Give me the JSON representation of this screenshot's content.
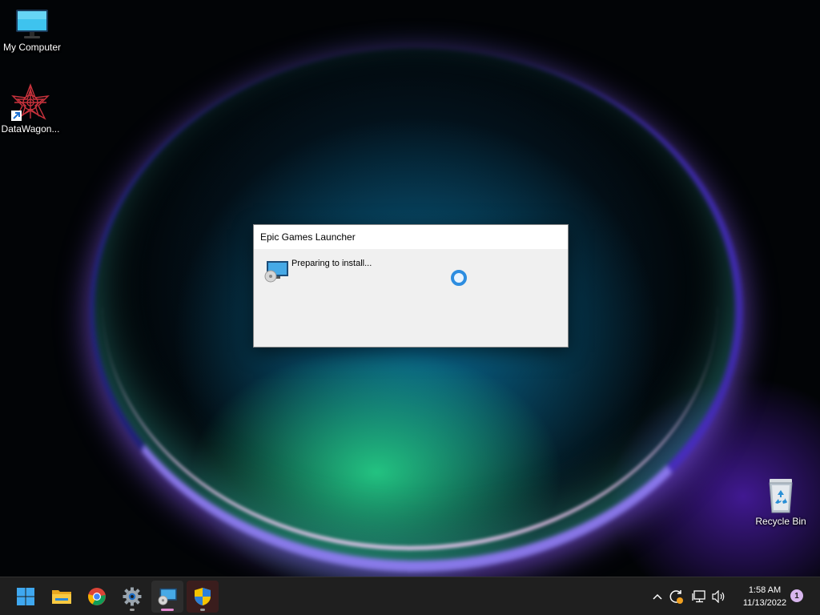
{
  "desktop": {
    "icons": [
      {
        "label": "My Computer"
      },
      {
        "label": "DataWagon..."
      },
      {
        "label": "Recycle Bin"
      }
    ]
  },
  "dialog": {
    "title": "Epic Games Launcher",
    "status": "Preparing to install..."
  },
  "taskbar": {
    "apps": [
      {
        "name": "start-icon"
      },
      {
        "name": "file-explorer-icon"
      },
      {
        "name": "chrome-icon"
      },
      {
        "name": "settings-icon"
      },
      {
        "name": "installer-icon"
      },
      {
        "name": "security-shield-icon"
      }
    ],
    "clock": {
      "time": "1:58 AM",
      "date": "11/13/2022"
    },
    "notification_count": "1"
  },
  "colors": {
    "taskbar_bg": "#1f1f1f",
    "dialog_bg": "#f0f0f0",
    "spinner_accent": "#2d8de0",
    "notification_badge": "#d8b6ee"
  }
}
